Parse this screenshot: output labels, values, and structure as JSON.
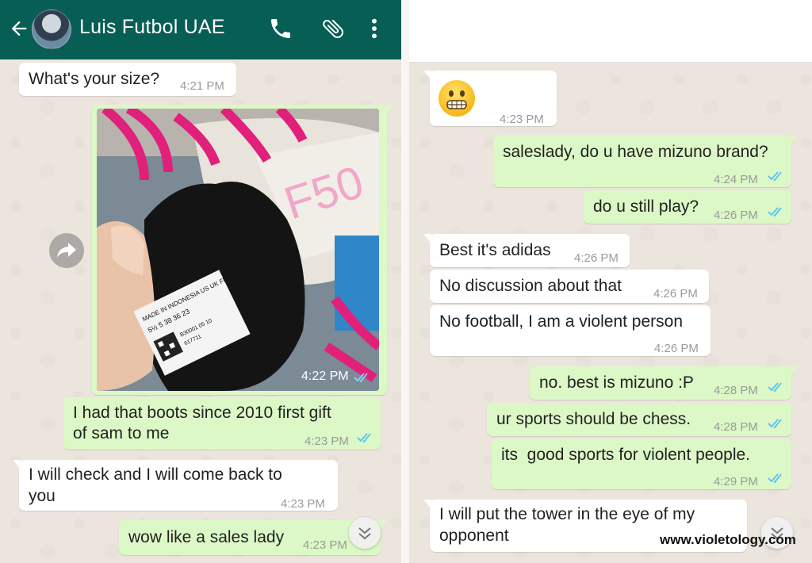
{
  "header": {
    "contact_name": "Luis Futbol UAE"
  },
  "icons": [
    "back-arrow-icon",
    "phone-icon",
    "paperclip-icon",
    "more-vert-icon",
    "forward-icon",
    "chevron-down-icon",
    "read-ticks-icon"
  ],
  "colors": {
    "header": "#075e54",
    "outgoing": "#dcf8c6",
    "incoming": "#ffffff",
    "ticks": "#4fc3f7"
  },
  "left_chat": {
    "messages": [
      {
        "dir": "in",
        "text": "What's your size?",
        "time": "4:21 PM"
      },
      {
        "dir": "out",
        "type": "image",
        "time": "4:22 PM",
        "label_text": "MADE IN INDONESIA US UK FR JP CHN"
      },
      {
        "dir": "out",
        "text_line1": "I had that boots since 2010 first gift",
        "text_line2": "of sam to me",
        "time": "4:23 PM"
      },
      {
        "dir": "in",
        "text_line1": "I will check and I will come back to",
        "text_line2": "you",
        "time": "4:23 PM"
      },
      {
        "dir": "out",
        "text": "wow like a sales lady",
        "time": "4:23 PM"
      }
    ]
  },
  "right_chat": {
    "messages": [
      {
        "dir": "in",
        "type": "emoji",
        "emoji": "grimacing-face",
        "time": "4:23 PM"
      },
      {
        "dir": "out",
        "text": "saleslady, do u have mizuno brand?",
        "time": "4:24 PM"
      },
      {
        "dir": "out",
        "text": "do u still play?",
        "time": "4:26 PM"
      },
      {
        "dir": "in",
        "text": "Best it's adidas",
        "time": "4:26 PM"
      },
      {
        "dir": "in",
        "text": "No discussion about that",
        "time": "4:26 PM"
      },
      {
        "dir": "in",
        "text": "No football, I am a violent person",
        "time": "4:26 PM"
      },
      {
        "dir": "out",
        "text": "no. best is mizuno :P",
        "time": "4:28 PM"
      },
      {
        "dir": "out",
        "text": "ur sports should be chess.",
        "time": "4:28 PM"
      },
      {
        "dir": "out",
        "text": "its  good sports for violent people.",
        "time": "4:29 PM"
      },
      {
        "dir": "in",
        "text_line1": "I will put the tower in the eye of my",
        "text_line2": "opponent"
      }
    ]
  },
  "watermark": "www.violetology.com"
}
